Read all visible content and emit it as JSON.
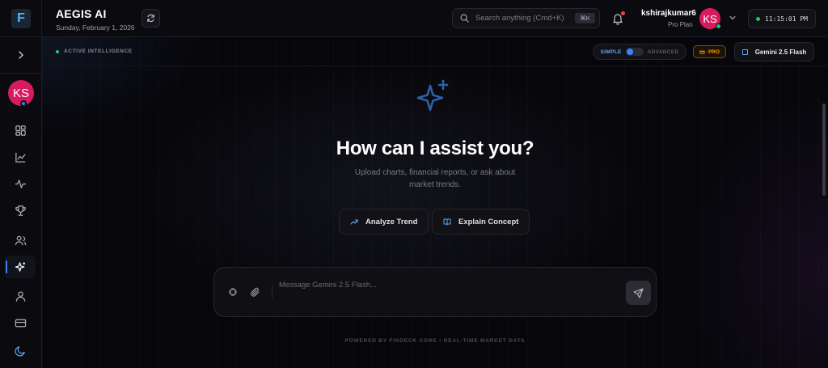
{
  "app": {
    "logo_letter": "F",
    "title": "AEGIS AI",
    "date": "Sunday, February 1, 2026"
  },
  "search": {
    "placeholder": "Search anything (Cmd+K)",
    "shortcut": "⌘K"
  },
  "user": {
    "name": "kshirajkumar6",
    "plan": "Pro Plan",
    "initials": "KS"
  },
  "clock": {
    "time": "11:15:01 PM"
  },
  "sidebar": {
    "items": [
      {
        "name": "dashboard",
        "icon": "grid-icon",
        "active": false
      },
      {
        "name": "analytics",
        "icon": "chart-icon",
        "active": false
      },
      {
        "name": "activity",
        "icon": "pulse-icon",
        "active": false
      },
      {
        "name": "achievements",
        "icon": "trophy-icon",
        "active": false
      },
      {
        "name": "community",
        "icon": "users-icon",
        "active": false
      },
      {
        "name": "ai-assistant",
        "icon": "sparkle-icon",
        "active": true
      },
      {
        "name": "profile",
        "icon": "user-icon",
        "active": false
      },
      {
        "name": "billing",
        "icon": "card-icon",
        "active": false
      },
      {
        "name": "theme",
        "icon": "moon-icon",
        "active": false
      }
    ]
  },
  "toolbar": {
    "status": "ACTIVE INTELLIGENCE",
    "mode_simple": "SIMPLE",
    "mode_advanced": "ADVANCED",
    "pro_badge": "PRO",
    "model": "Gemini 2.5 Flash"
  },
  "hero": {
    "title": "How can I assist you?",
    "subtitle": "Upload charts, financial reports, or ask about market trends."
  },
  "suggestions": [
    {
      "label": "Analyze Trend",
      "icon": "trend-up-icon"
    },
    {
      "label": "Explain Concept",
      "icon": "book-icon"
    }
  ],
  "composer": {
    "placeholder": "Message Gemini 2.5 Flash..."
  },
  "footer": {
    "note": "POWERED BY FINDECK CORE • REAL-TIME MARKET DATA"
  },
  "colors": {
    "accent": "#3b82f6",
    "avatar": "#d81b60",
    "online": "#22c55e",
    "pro": "#f59e0b"
  }
}
